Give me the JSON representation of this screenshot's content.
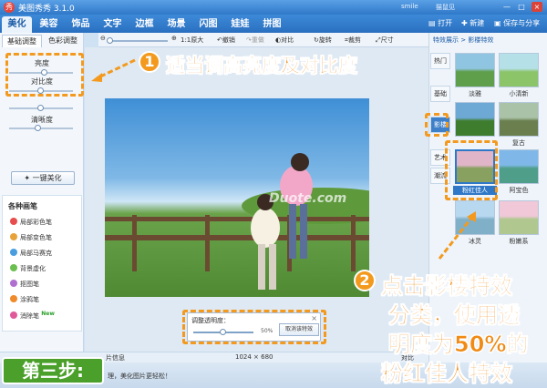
{
  "window": {
    "title": "美图秀秀 3.1.0",
    "user_label": "smile",
    "user_name": "猫鼠见",
    "icon": "app-logo-icon",
    "min": "—",
    "max": "□",
    "close": "×"
  },
  "menu": {
    "tabs": [
      "美化",
      "美容",
      "饰品",
      "文字",
      "边框",
      "场景",
      "闪图",
      "娃娃",
      "拼图"
    ],
    "open": "打开",
    "new": "新建",
    "save": "保存与分享"
  },
  "toolbar": {
    "original": "1:1原大",
    "rotate_left": "撤销",
    "redo": "重做",
    "compare": "对比",
    "rotate": "旋转",
    "crop": "裁剪",
    "size": "尺寸"
  },
  "left_panel": {
    "tabs": [
      "基础调整",
      "色彩调整"
    ],
    "adjust": [
      {
        "label": "亮度",
        "value": 0.55
      },
      {
        "label": "对比度",
        "value": 0.5
      },
      {
        "label": "",
        "value": 0.5
      },
      {
        "label": "清晰度",
        "value": 0.45
      }
    ],
    "beautify_button": "一键美化",
    "brushes_title": "各种画笔",
    "brushes": [
      {
        "label": "局部彩色笔",
        "color": "#e84d4d"
      },
      {
        "label": "局部变色笔",
        "color": "#e8a23a"
      },
      {
        "label": "局部马赛克",
        "color": "#4a9ee0"
      },
      {
        "label": "背景虚化",
        "color": "#6bbf4f"
      },
      {
        "label": "抠图笔",
        "color": "#b070d0"
      },
      {
        "label": "涂鸦笔",
        "color": "#f08a2a"
      },
      {
        "label": "消除笔",
        "color": "#e05a9a"
      }
    ],
    "new_badge": "New"
  },
  "canvas": {
    "watermark": "Duote.com"
  },
  "opacity_dialog": {
    "label": "调整透明度：",
    "value_text": "50%",
    "value": 0.5,
    "cancel": "取消该特效"
  },
  "statusbar": {
    "info": "片信息",
    "dims": "1024 × 680",
    "compare": "对比",
    "tip": "理，美化图片更轻松！"
  },
  "right_panel": {
    "header": "特效展示 > 影楼特效",
    "categories": [
      "热门",
      "基础",
      "影楼",
      "艺术",
      "潮流"
    ],
    "thumbs": [
      {
        "label": "淡雅",
        "colors": [
          "#8fc5e0",
          "#5f9e4a"
        ]
      },
      {
        "label": "小清新",
        "colors": [
          "#b5e0e8",
          "#8cc46a"
        ]
      },
      {
        "label": "",
        "colors": [
          "#6ea9d6",
          "#3f7d2e"
        ]
      },
      {
        "label": "复古",
        "colors": [
          "#a9c2a8",
          "#6b7e4e"
        ]
      },
      {
        "label": "粉红佳人",
        "colors": [
          "#e0b5c8",
          "#88a060"
        ]
      },
      {
        "label": "阿宝色",
        "colors": [
          "#7fb8e8",
          "#4f9e8a"
        ]
      },
      {
        "label": "冰灵",
        "colors": [
          "#b8d8f0",
          "#7fb0c8"
        ]
      },
      {
        "label": "粉嫩系",
        "colors": [
          "#f0c8d8",
          "#b0c890"
        ]
      }
    ]
  },
  "annotations": {
    "badge_1": "1",
    "text_1": "适当调高亮度及对比度",
    "badge_2": "2",
    "text_2_line1": "点击影楼特效",
    "text_2_line2": "分类，使用透",
    "text_2_line3": "明度为50%的",
    "text_2_line4": "粉红佳人特效",
    "step": "第三步:"
  }
}
